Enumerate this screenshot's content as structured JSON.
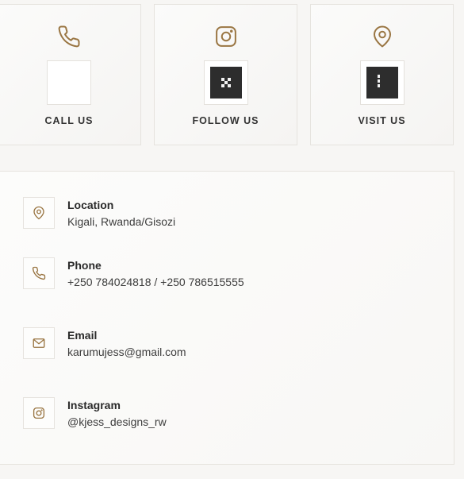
{
  "colors": {
    "accent": "#9a7643",
    "qr_dark": "#2d2d2d",
    "border": "#e6e3de"
  },
  "cards": [
    {
      "icon": "phone-icon",
      "label": "CALL US"
    },
    {
      "icon": "instagram-icon",
      "label": "FOLLOW US"
    },
    {
      "icon": "map-pin-icon",
      "label": "VISIT US"
    }
  ],
  "contacts": [
    {
      "icon": "map-pin-icon",
      "title": "Location",
      "value": "Kigali, Rwanda/Gisozi"
    },
    {
      "icon": "phone-icon",
      "title": "Phone",
      "value": "+250 784024818 / +250 786515555"
    },
    {
      "icon": "mail-icon",
      "title": "Email",
      "value": "karumujess@gmail.com"
    },
    {
      "icon": "instagram-icon",
      "title": "Instagram",
      "value": "@kjess_designs_rw"
    }
  ]
}
